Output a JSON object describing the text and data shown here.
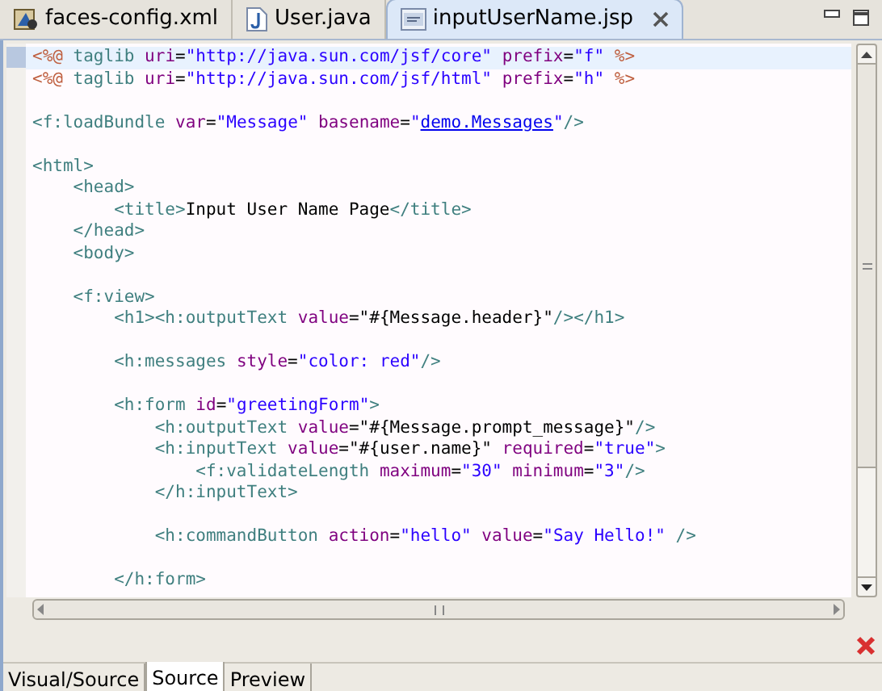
{
  "editor_tabs": [
    {
      "label": "faces-config.xml",
      "kind": "xml",
      "selected": false
    },
    {
      "label": "User.java",
      "kind": "java",
      "selected": false
    },
    {
      "label": "inputUserName.jsp",
      "kind": "jsp",
      "selected": true
    }
  ],
  "code_lines": [
    {
      "current": true,
      "tokens": [
        {
          "kind": "directive",
          "text": "<%@"
        },
        {
          "kind": "tag",
          "text": " taglib "
        },
        {
          "kind": "attr",
          "text": "uri"
        },
        {
          "kind": "plain",
          "text": "="
        },
        {
          "kind": "value",
          "text": "\"http://java.sun.com/jsf/core\""
        },
        {
          "kind": "attr",
          "text": " prefix"
        },
        {
          "kind": "plain",
          "text": "="
        },
        {
          "kind": "value",
          "text": "\"f\""
        },
        {
          "kind": "directive",
          "text": " %>"
        }
      ]
    },
    {
      "current": false,
      "tokens": [
        {
          "kind": "directive",
          "text": "<%@"
        },
        {
          "kind": "tag",
          "text": " taglib "
        },
        {
          "kind": "attr",
          "text": "uri"
        },
        {
          "kind": "plain",
          "text": "="
        },
        {
          "kind": "value",
          "text": "\"http://java.sun.com/jsf/html\""
        },
        {
          "kind": "attr",
          "text": " prefix"
        },
        {
          "kind": "plain",
          "text": "="
        },
        {
          "kind": "value",
          "text": "\"h\""
        },
        {
          "kind": "directive",
          "text": " %>"
        }
      ]
    },
    {
      "current": false
    },
    {
      "current": false,
      "tokens": [
        {
          "kind": "tag",
          "text": "<f:loadBundle "
        },
        {
          "kind": "attr",
          "text": "var"
        },
        {
          "kind": "plain",
          "text": "="
        },
        {
          "kind": "value",
          "text": "\"Message\""
        },
        {
          "kind": "attr",
          "text": " basename"
        },
        {
          "kind": "plain",
          "text": "="
        },
        {
          "kind": "value",
          "text": "\""
        },
        {
          "kind": "link",
          "text": "demo.Messages"
        },
        {
          "kind": "value",
          "text": "\""
        },
        {
          "kind": "tag",
          "text": "/>"
        }
      ]
    },
    {
      "current": false
    },
    {
      "current": false,
      "tokens": [
        {
          "kind": "tag",
          "text": "<html>"
        }
      ]
    },
    {
      "current": false,
      "tokens": [
        {
          "kind": "tag",
          "text": "    <head>"
        }
      ]
    },
    {
      "current": false,
      "tokens": [
        {
          "kind": "tag",
          "text": "        <title>"
        },
        {
          "kind": "plain",
          "text": "Input User Name Page"
        },
        {
          "kind": "tag",
          "text": "</title>"
        }
      ]
    },
    {
      "current": false,
      "tokens": [
        {
          "kind": "tag",
          "text": "    </head>"
        }
      ]
    },
    {
      "current": false,
      "tokens": [
        {
          "kind": "tag",
          "text": "    <body>"
        }
      ]
    },
    {
      "current": false
    },
    {
      "current": false,
      "tokens": [
        {
          "kind": "tag",
          "text": "    <f:view>"
        }
      ]
    },
    {
      "current": false,
      "tokens": [
        {
          "kind": "tag",
          "text": "        <h1><h:outputText "
        },
        {
          "kind": "attr",
          "text": "value"
        },
        {
          "kind": "plain",
          "text": "=\"#{Message.header}\""
        },
        {
          "kind": "tag",
          "text": "/></h1>"
        }
      ]
    },
    {
      "current": false
    },
    {
      "current": false,
      "tokens": [
        {
          "kind": "tag",
          "text": "        <h:messages "
        },
        {
          "kind": "attr",
          "text": "style"
        },
        {
          "kind": "plain",
          "text": "="
        },
        {
          "kind": "value",
          "text": "\"color: red\""
        },
        {
          "kind": "tag",
          "text": "/>"
        }
      ]
    },
    {
      "current": false
    },
    {
      "current": false,
      "tokens": [
        {
          "kind": "tag",
          "text": "        <h:form "
        },
        {
          "kind": "attr",
          "text": "id"
        },
        {
          "kind": "plain",
          "text": "="
        },
        {
          "kind": "value",
          "text": "\"greetingForm\""
        },
        {
          "kind": "tag",
          "text": ">"
        }
      ]
    },
    {
      "current": false,
      "tokens": [
        {
          "kind": "tag",
          "text": "            <h:outputText "
        },
        {
          "kind": "attr",
          "text": "value"
        },
        {
          "kind": "plain",
          "text": "=\"#{Message.prompt_message}\""
        },
        {
          "kind": "tag",
          "text": "/>"
        }
      ]
    },
    {
      "current": false,
      "tokens": [
        {
          "kind": "tag",
          "text": "            <h:inputText "
        },
        {
          "kind": "attr",
          "text": "value"
        },
        {
          "kind": "plain",
          "text": "=\"#{user.name}\""
        },
        {
          "kind": "attr",
          "text": " required"
        },
        {
          "kind": "plain",
          "text": "="
        },
        {
          "kind": "value",
          "text": "\"true\""
        },
        {
          "kind": "tag",
          "text": ">"
        }
      ]
    },
    {
      "current": false,
      "tokens": [
        {
          "kind": "tag",
          "text": "                <f:validateLength "
        },
        {
          "kind": "attr",
          "text": "maximum"
        },
        {
          "kind": "plain",
          "text": "="
        },
        {
          "kind": "value",
          "text": "\"30\""
        },
        {
          "kind": "attr",
          "text": " minimum"
        },
        {
          "kind": "plain",
          "text": "="
        },
        {
          "kind": "value",
          "text": "\"3\""
        },
        {
          "kind": "tag",
          "text": "/>"
        }
      ]
    },
    {
      "current": false,
      "tokens": [
        {
          "kind": "tag",
          "text": "            </h:inputText>"
        }
      ]
    },
    {
      "current": false
    },
    {
      "current": false,
      "tokens": [
        {
          "kind": "tag",
          "text": "            <h:commandButton "
        },
        {
          "kind": "attr",
          "text": "action"
        },
        {
          "kind": "plain",
          "text": "="
        },
        {
          "kind": "value",
          "text": "\"hello\""
        },
        {
          "kind": "attr",
          "text": " value"
        },
        {
          "kind": "plain",
          "text": "="
        },
        {
          "kind": "value",
          "text": "\"Say Hello!\""
        },
        {
          "kind": "tag",
          "text": " />"
        }
      ]
    },
    {
      "current": false
    },
    {
      "current": false,
      "tokens": [
        {
          "kind": "tag",
          "text": "        </h:form>"
        }
      ]
    }
  ],
  "bottom_tabs": [
    {
      "label": "Visual/Source",
      "selected": false
    },
    {
      "label": "Source",
      "selected": true
    },
    {
      "label": "Preview",
      "selected": false
    }
  ]
}
